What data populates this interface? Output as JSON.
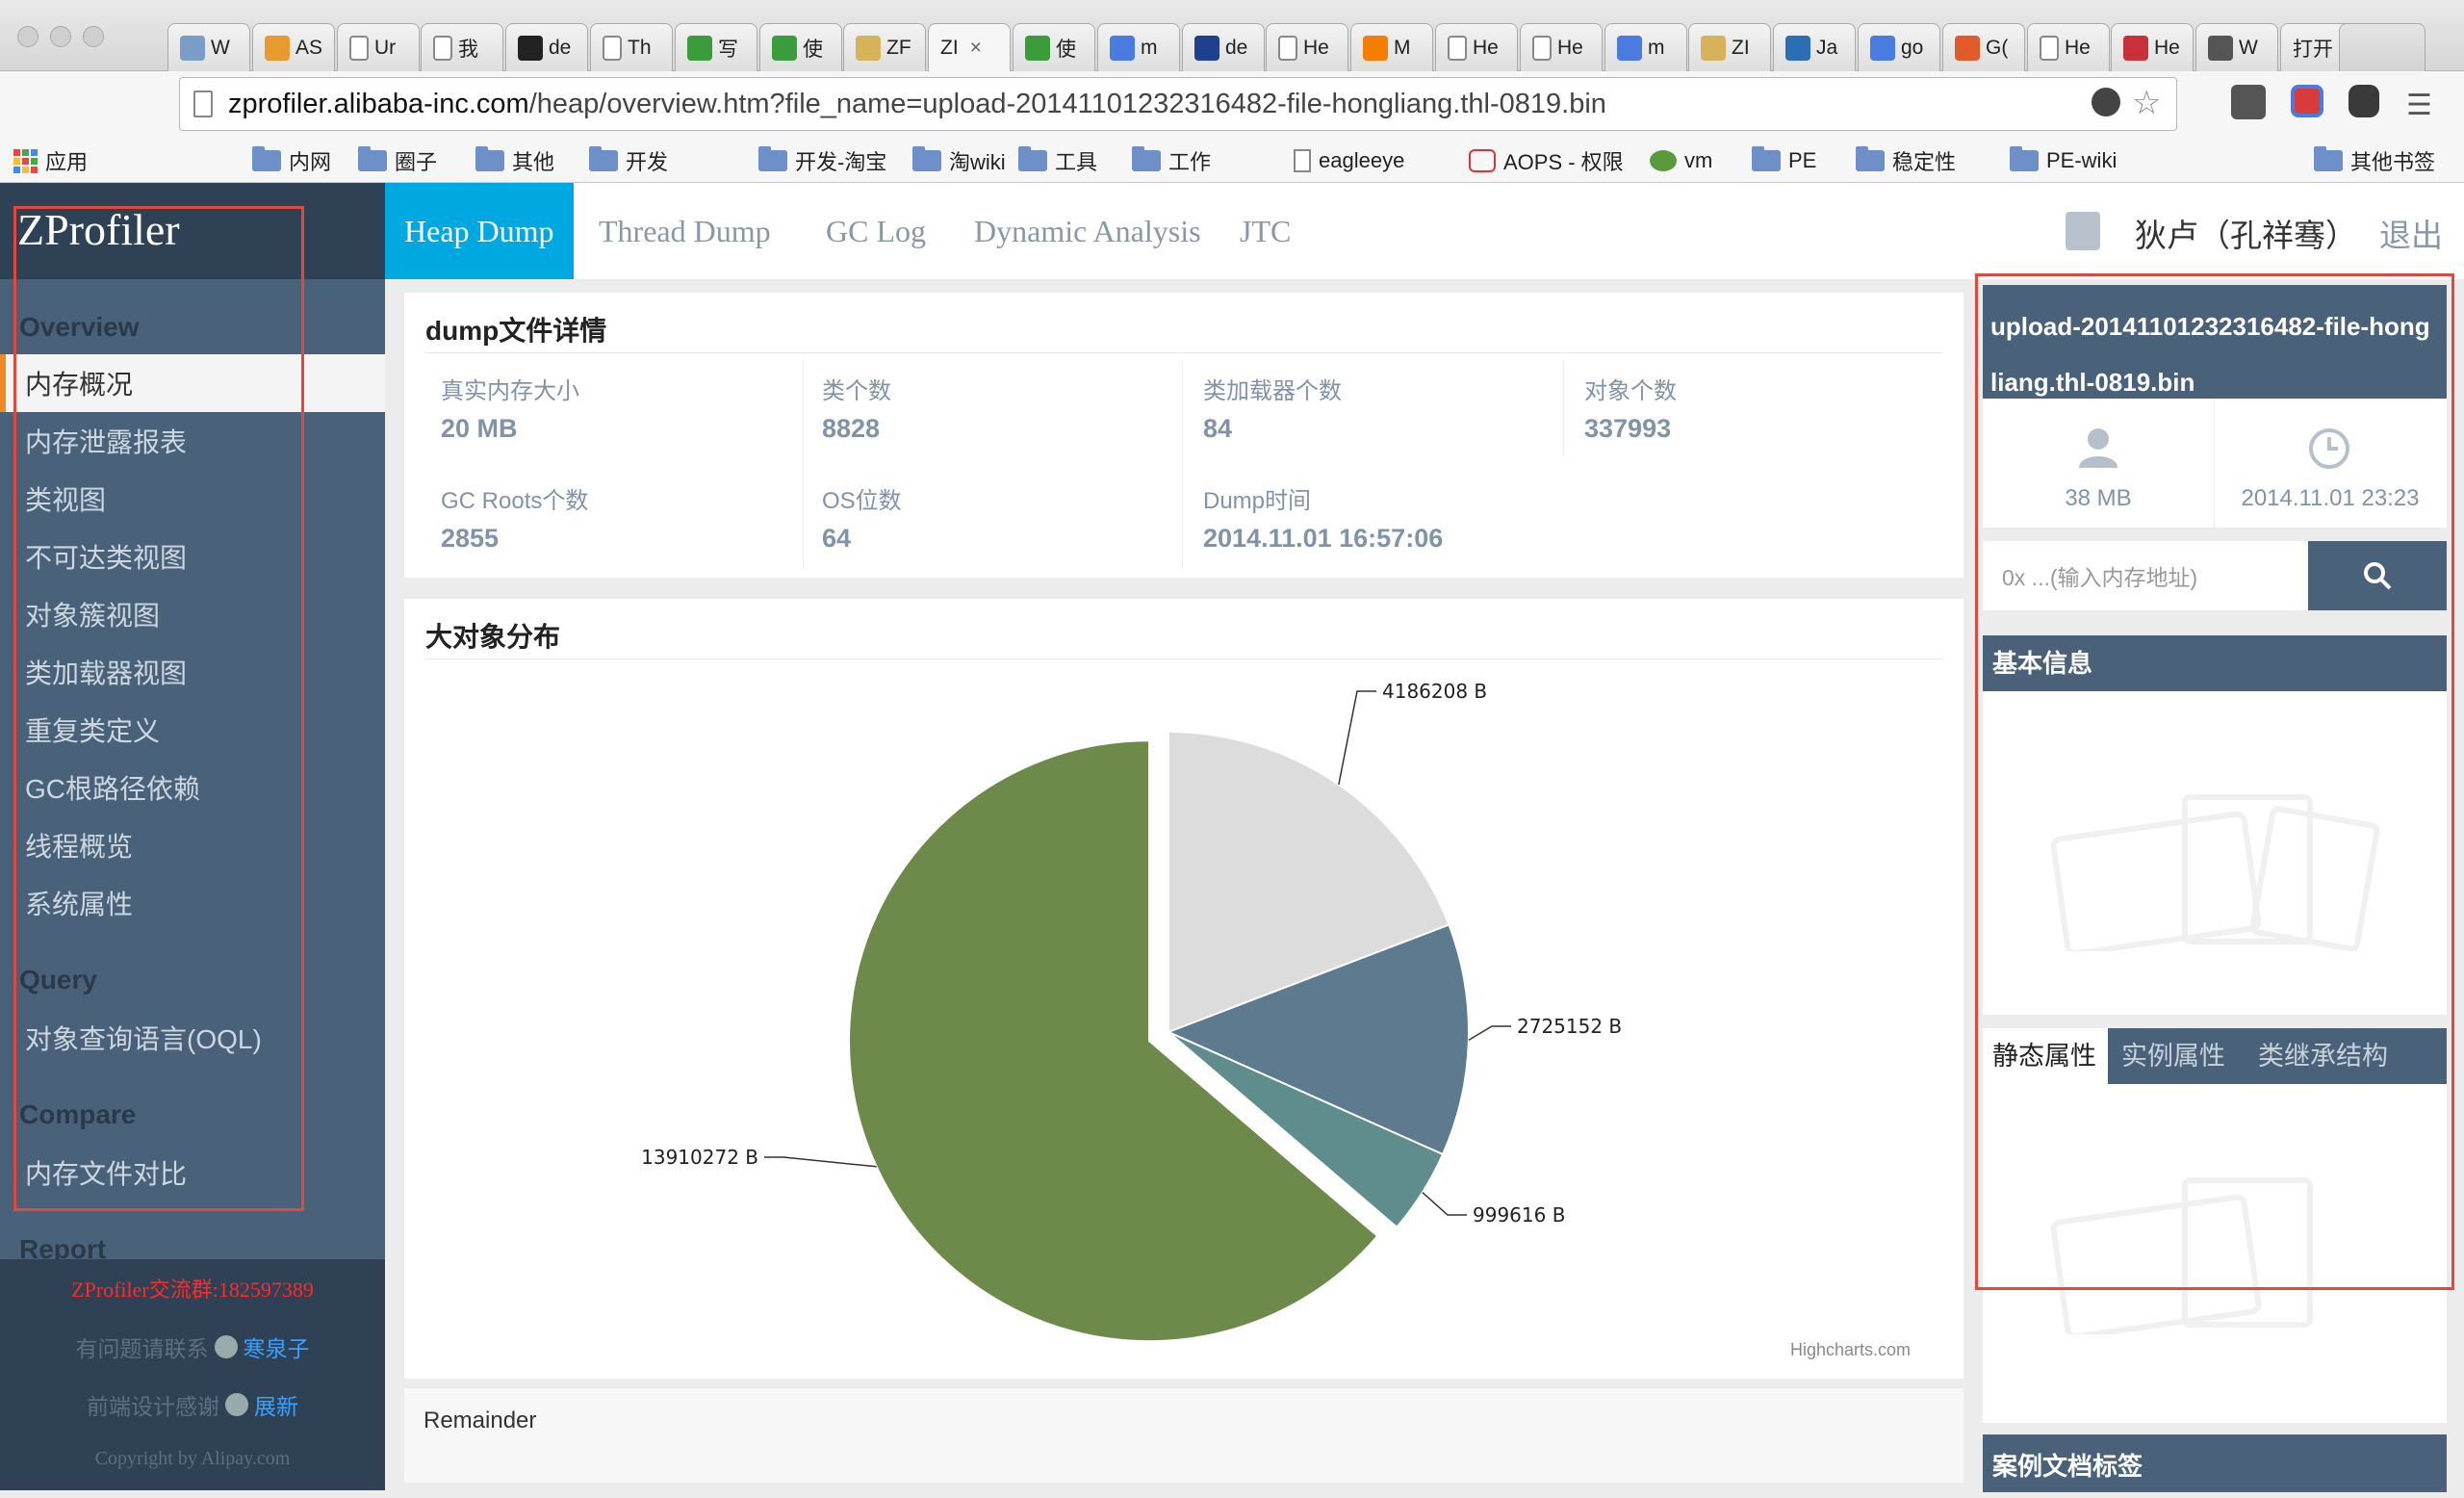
{
  "browser": {
    "tabs": [
      {
        "label": "W",
        "icon": "crossed-tools-icon",
        "color": "#7a9cc6"
      },
      {
        "label": "AS",
        "icon": "ow2-icon",
        "color": "#e89a2e"
      },
      {
        "label": "Ur",
        "icon": "page-icon",
        "color": "#ffffff"
      },
      {
        "label": "我",
        "icon": "page-icon",
        "color": "#ffffff"
      },
      {
        "label": "de",
        "icon": "github-icon",
        "color": "#222222"
      },
      {
        "label": "Th",
        "icon": "page-icon",
        "color": "#ffffff"
      },
      {
        "label": "写",
        "icon": "code-icon",
        "color": "#3a9c3a"
      },
      {
        "label": "使",
        "icon": "code-icon",
        "color": "#3a9c3a"
      },
      {
        "label": "ZF",
        "icon": "avatar-icon",
        "color": "#d6b35a"
      },
      {
        "label": "ZI",
        "icon": "none",
        "color": "#ffffff"
      },
      {
        "label": "使",
        "icon": "code-icon",
        "color": "#3a9c3a"
      },
      {
        "label": "m",
        "icon": "google-g-icon",
        "color": "#4a7be0"
      },
      {
        "label": "de",
        "icon": "ibm-icon",
        "color": "#1f3f8f"
      },
      {
        "label": "He",
        "icon": "page-icon",
        "color": "#ffffff"
      },
      {
        "label": "M",
        "icon": "blogger-icon",
        "color": "#f57d00"
      },
      {
        "label": "He",
        "icon": "page-icon",
        "color": "#ffffff"
      },
      {
        "label": "He",
        "icon": "page-icon",
        "color": "#ffffff"
      },
      {
        "label": "m",
        "icon": "google-g-icon",
        "color": "#4a7be0"
      },
      {
        "label": "ZI",
        "icon": "avatar-icon",
        "color": "#d6b35a"
      },
      {
        "label": "Ja",
        "icon": "infoq-icon",
        "color": "#2a6fb5"
      },
      {
        "label": "go",
        "icon": "google-g-icon",
        "color": "#4a7be0"
      },
      {
        "label": "G(",
        "icon": "gear-icon",
        "color": "#e05a2a"
      },
      {
        "label": "He",
        "icon": "page-icon",
        "color": "#ffffff"
      },
      {
        "label": "He",
        "icon": "book-icon",
        "color": "#c8303a"
      },
      {
        "label": "W",
        "icon": "cat-icon",
        "color": "#555555"
      },
      {
        "label": "打开",
        "icon": "none",
        "color": "#ffffff"
      }
    ],
    "url_host": "zprofiler.alibaba-inc.com",
    "url_path": "/heap/overview.htm?file_name=upload-20141101232316482-file-hongliang.thl-0819.bin",
    "bookmarks": [
      "应用",
      "内网",
      "圈子",
      "其他",
      "开发",
      "开发-淘宝",
      "淘wiki",
      "工具",
      "工作",
      "eagleeye",
      "AOPS - 权限",
      "vm",
      "PE",
      "稳定性",
      "PE-wiki"
    ],
    "bookmarks_other": "其他书签"
  },
  "app": {
    "logo": "ZProfiler",
    "topnav": [
      "Heap Dump",
      "Thread Dump",
      "GC Log",
      "Dynamic Analysis",
      "JTC"
    ],
    "user_name": "狄卢（孔祥骞）",
    "logout": "退出",
    "sidebar": {
      "overview_title": "Overview",
      "overview_items": [
        "内存概况",
        "内存泄露报表",
        "类视图",
        "不可达类视图",
        "对象簇视图",
        "类加载器视图",
        "重复类定义",
        "GC根路径依赖",
        "线程概览",
        "系统属性"
      ],
      "query_title": "Query",
      "query_items": [
        "对象查询语言(OQL)"
      ],
      "compare_title": "Compare",
      "compare_items": [
        "内存文件对比"
      ],
      "report_title": "Report",
      "footer_group": "ZProfiler交流群:182597389",
      "footer_contact_prefix": "有问题请联系",
      "footer_contact_name": "寒泉子",
      "footer_design_prefix": "前端设计感谢",
      "footer_design_name": "展新",
      "copyright": "Copyright by Alipay.com"
    },
    "dump": {
      "title": "dump文件详情",
      "stats": [
        {
          "label": "真实内存大小",
          "value": "20 MB"
        },
        {
          "label": "类个数",
          "value": "8828"
        },
        {
          "label": "类加载器个数",
          "value": "84"
        },
        {
          "label": "对象个数",
          "value": "337993"
        },
        {
          "label": "GC Roots个数",
          "value": "2855"
        },
        {
          "label": "OS位数",
          "value": "64"
        },
        {
          "label": "Dump时间",
          "value": "2014.11.01 16:57:06"
        }
      ]
    },
    "dist": {
      "title": "大对象分布",
      "credit": "Highcharts.com",
      "remainder": "Remainder"
    },
    "right": {
      "filename": "upload-20141101232316482-file-hongliang.thl-0819.bin",
      "size": "38 MB",
      "time": "2014.11.01 23:23",
      "address_placeholder": "0x ...(输入内存地址)",
      "basic_info": "基本信息",
      "tabs": [
        "静态属性",
        "实例属性",
        "类继承结构"
      ],
      "case_tags": "案例文档标签"
    }
  },
  "chart_data": {
    "type": "pie",
    "title": "",
    "slices": [
      {
        "label": "4186208 B",
        "value": 4186208,
        "color": "#dcdcdc"
      },
      {
        "label": "2725152 B",
        "value": 2725152,
        "color": "#5d7a8f"
      },
      {
        "label": "999616 B",
        "value": 999616,
        "color": "#5f8d8d"
      },
      {
        "label": "13910272 B",
        "value": 13910272,
        "color": "#6e8a4b",
        "exploded": true
      }
    ]
  }
}
